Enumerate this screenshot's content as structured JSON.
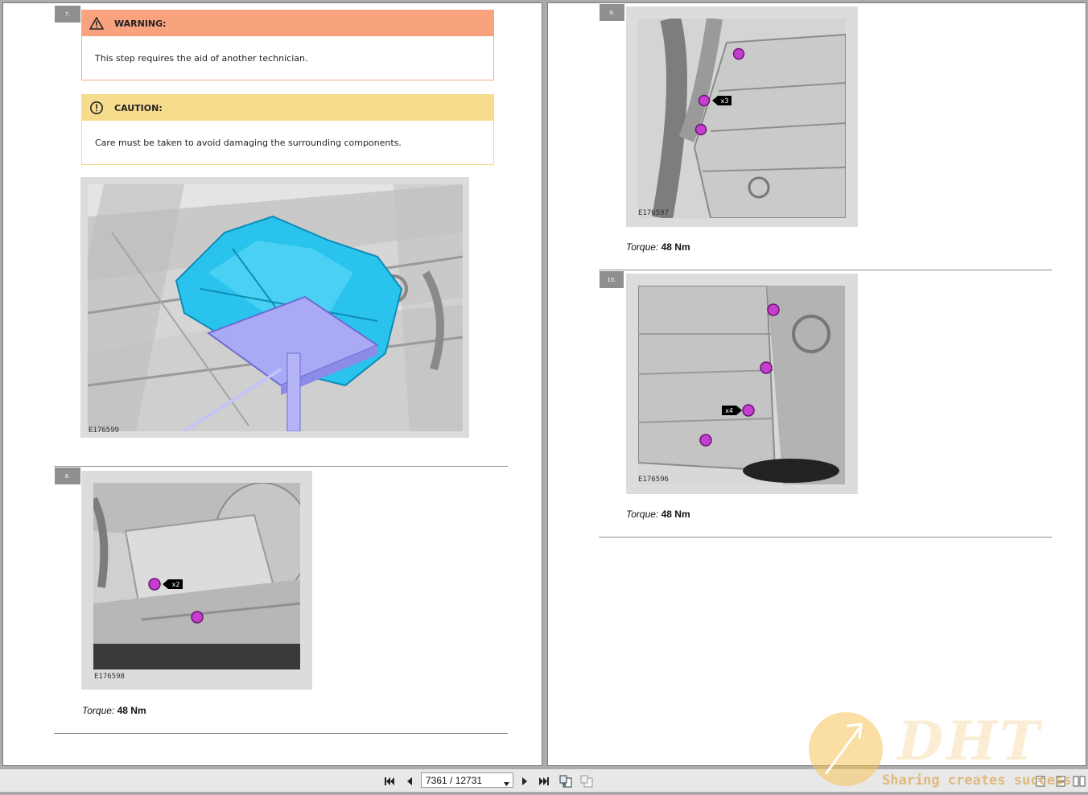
{
  "left_page": {
    "step7": {
      "number": "7.",
      "warning": {
        "title": "WARNING:",
        "text": "This step requires the aid of another technician."
      },
      "caution": {
        "title": "CAUTION:",
        "text": "Care must be taken to avoid damaging the surrounding components."
      },
      "figure_code": "E176599"
    },
    "step8": {
      "number": "8.",
      "figure_code": "E176598",
      "callout": "x2",
      "torque_label": "Torque:",
      "torque_value": "48 Nm"
    }
  },
  "right_page": {
    "step9": {
      "number": "9.",
      "figure_code": "E176597",
      "callout": "x3",
      "torque_label": "Torque:",
      "torque_value": "48 Nm"
    },
    "step10": {
      "number": "10.",
      "figure_code": "E176596",
      "callout": "x4",
      "torque_label": "Torque:",
      "torque_value": "48 Nm"
    }
  },
  "toolbar": {
    "page_indicator": "7361 / 12731"
  },
  "watermark": {
    "logo_text": "DHT",
    "tagline": "Sharing creates success"
  },
  "colors": {
    "warning_header": "#f9a27e",
    "warning_border": "#f1a98c",
    "caution_header": "#f8dc8e",
    "caution_border": "#f2d98a",
    "highlight_cyan": "#29c3ee",
    "highlight_jack": "#a9a9f5",
    "fastener_magenta": "#c53ecf"
  }
}
